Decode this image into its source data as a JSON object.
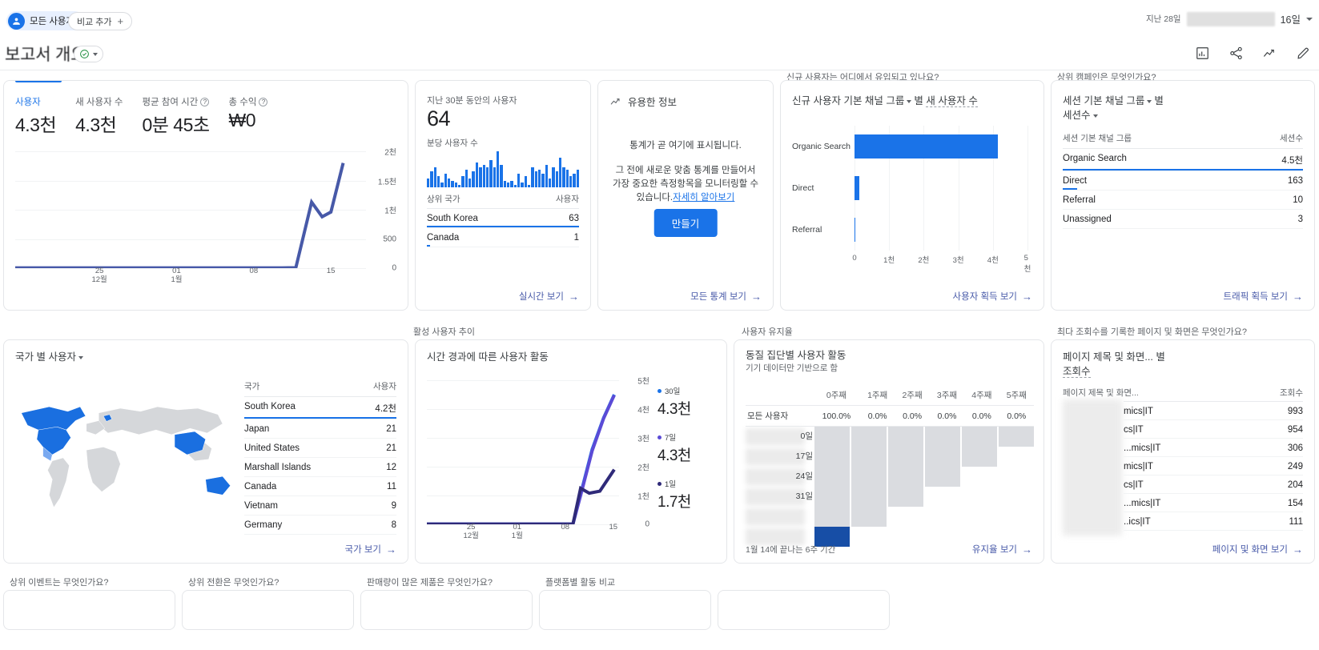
{
  "topbar": {
    "audience_label": "모든 사용자",
    "compare_label": "비교 추가",
    "compare_plus": "+",
    "date_prefix": "지난 28일",
    "date_days": "16일"
  },
  "title": {
    "page_title": "보고서 개요"
  },
  "overview": {
    "metrics": [
      {
        "label": "사용자",
        "value": "4.3천",
        "help": false
      },
      {
        "label": "새 사용자 수",
        "value": "4.3천",
        "help": false
      },
      {
        "label": "평균 참여 시간",
        "value": "0분 45초",
        "help": true
      },
      {
        "label": "총 수익",
        "value": "₩0",
        "help": true
      }
    ]
  },
  "realtime": {
    "sub": "지난 30분 동안의 사용자",
    "value": "64",
    "sub2": "분당 사용자 수",
    "col_country": "상위 국가",
    "col_users": "사용자",
    "rows": [
      {
        "name": "South Korea",
        "value": "63",
        "pct": 100
      },
      {
        "name": "Canada",
        "value": "1",
        "pct": 2
      }
    ],
    "footer": "실시간 보기"
  },
  "insights": {
    "head": "유용한 정보",
    "text1": "통계가 곧 여기에 표시됩니다.",
    "text2": "그 전에 새로운 맞춤 통계를 만들어서 가장 중요한 측정항목을 모니터링할 수 있습니다.",
    "link": "자세히 알아보기",
    "button": "만들기",
    "footer": "모든 통계 보기"
  },
  "acquisition": {
    "section_title": "신규 사용자는 어디에서 유입되고 있나요?",
    "dimension": "신규 사용자 기본 채널 그룹",
    "by": "별",
    "metric": "새 사용자 수",
    "footer": "사용자 획득 보기"
  },
  "campaigns": {
    "section_title": "상위 캠페인은 무엇인가요?",
    "dimension": "세션 기본 채널 그룹",
    "by": "별",
    "metric": "세션수",
    "col_dim": "세션 기본 채널 그룹",
    "col_metric": "세션수",
    "rows": [
      {
        "name": "Organic Search",
        "value": "4.5천",
        "pct": 100
      },
      {
        "name": "Direct",
        "value": "163",
        "pct": 4
      },
      {
        "name": "Referral",
        "value": "10",
        "pct": 0.5
      },
      {
        "name": "Unassigned",
        "value": "3",
        "pct": 0.2
      }
    ],
    "footer": "트래픽 획득 보기"
  },
  "map": {
    "dimension": "국가 별 사용자",
    "col_country": "국가",
    "col_users": "사용자",
    "rows": [
      {
        "name": "South Korea",
        "value": "4.2천",
        "pct": 100
      },
      {
        "name": "Japan",
        "value": "21",
        "pct": 0.5
      },
      {
        "name": "United States",
        "value": "21",
        "pct": 0.5
      },
      {
        "name": "Marshall Islands",
        "value": "12",
        "pct": 0.3
      },
      {
        "name": "Canada",
        "value": "11",
        "pct": 0.3
      },
      {
        "name": "Vietnam",
        "value": "9",
        "pct": 0.2
      },
      {
        "name": "Germany",
        "value": "8",
        "pct": 0.2
      }
    ],
    "footer": "국가 보기"
  },
  "active_users": {
    "section_title": "활성 사용자 추이",
    "card_title": "시간 경과에 따른 사용자 활동",
    "legend": [
      {
        "key": "30일",
        "value": "4.3천",
        "color": "#1a73e8"
      },
      {
        "key": "7일",
        "value": "4.3천",
        "color": "#5b4bd6"
      },
      {
        "key": "1일",
        "value": "1.7천",
        "color": "#2f2a79"
      }
    ]
  },
  "retention": {
    "section_title": "사용자 유지율",
    "card_title": "동질 집단별 사용자 활동",
    "card_sub": "기기 데이터만 기반으로 함",
    "columns": [
      "",
      "0주째",
      "1주째",
      "2주째",
      "3주째",
      "4주째",
      "5주째"
    ],
    "all_users_row": {
      "name": "모든 사용자",
      "values": [
        "100.0%",
        "0.0%",
        "0.0%",
        "0.0%",
        "0.0%",
        "0.0%"
      ]
    },
    "cohort_rows": [
      {
        "label": "0일",
        "cells": [
          "f",
          "f",
          "f",
          "f",
          "f",
          "f"
        ]
      },
      {
        "label": "17일",
        "cells": [
          "f",
          "f",
          "f",
          "f",
          "f",
          "e"
        ]
      },
      {
        "label": "24일",
        "cells": [
          "f",
          "f",
          "f",
          "f",
          "e",
          "e"
        ]
      },
      {
        "label": "31일",
        "cells": [
          "f",
          "f",
          "f",
          "e",
          "e",
          "e"
        ]
      },
      {
        "label": "",
        "cells": [
          "f",
          "f",
          "e",
          "e",
          "e",
          "e"
        ]
      },
      {
        "label": "",
        "cells": [
          "b",
          "e",
          "e",
          "e",
          "e",
          "e"
        ]
      }
    ],
    "note": "1월 14에 끝나는 6주 기간",
    "footer": "유지율 보기"
  },
  "pages": {
    "section_title": "최다 조회수를 기록한 페이지 및 화면은 무엇인가요?",
    "dimension": "페이지 제목 및 화면...",
    "by": "별",
    "metric": "조회수",
    "col_dim": "페이지 제목 및 화면...",
    "col_metric": "조회수",
    "rows": [
      {
        "name": "mics|IT",
        "value": "993"
      },
      {
        "name": "cs|IT",
        "value": "954"
      },
      {
        "name": "...mics|IT",
        "value": "306"
      },
      {
        "name": "mics|IT",
        "value": "249"
      },
      {
        "name": "cs|IT",
        "value": "204"
      },
      {
        "name": "...mics|IT",
        "value": "154"
      },
      {
        "name": "..ics|IT",
        "value": "111"
      }
    ],
    "footer": "페이지 및 화면 보기"
  },
  "bottom_sections": [
    {
      "title": "상위 이벤트는 무엇인가요?"
    },
    {
      "title": "상위 전환은 무엇인가요?"
    },
    {
      "title": "판매량이 많은 제품은 무엇인가요?"
    },
    {
      "title": "플랫폼별 활동 비교"
    }
  ],
  "chart_data": [
    {
      "type": "line",
      "id": "overview-users-over-time",
      "title": "사용자",
      "xlabel": "",
      "ylabel": "",
      "ylim": [
        0,
        2000
      ],
      "yticks": [
        "0",
        "500",
        "1천",
        "1.5천",
        "2천"
      ],
      "xticks": [
        {
          "label": "25",
          "sub": "12월",
          "pos": 0.24
        },
        {
          "label": "01",
          "sub": "1월",
          "pos": 0.46
        },
        {
          "label": "08",
          "sub": "",
          "pos": 0.68
        },
        {
          "label": "15",
          "sub": "",
          "pos": 0.9
        }
      ],
      "series": [
        {
          "name": "사용자",
          "color": "#4759a8",
          "x": [
            0,
            0.1,
            0.24,
            0.35,
            0.46,
            0.57,
            0.68,
            0.76,
            0.8,
            0.845,
            0.875,
            0.9,
            0.935
          ],
          "values": [
            5,
            5,
            5,
            5,
            5,
            5,
            5,
            5,
            8,
            1130,
            880,
            960,
            1800
          ]
        }
      ]
    },
    {
      "type": "bar",
      "id": "realtime-users-per-minute",
      "title": "분당 사용자 수",
      "values": [
        4,
        7,
        9,
        5,
        2,
        6,
        4,
        3,
        2,
        1,
        5,
        8,
        4,
        7,
        11,
        9,
        10,
        9,
        12,
        9,
        16,
        10,
        3,
        2,
        3,
        1,
        6,
        2,
        5,
        1,
        9,
        7,
        8,
        6,
        10,
        4,
        9,
        7,
        13,
        9,
        8,
        5,
        6,
        8
      ],
      "ylim": [
        0,
        16
      ]
    },
    {
      "type": "bar",
      "id": "new-users-by-channel",
      "orientation": "horizontal",
      "title": "신규 사용자 기본 채널 그룹 별 새 사용자 수",
      "categories": [
        "Organic Search",
        "Direct",
        "Referral"
      ],
      "values": [
        4150,
        150,
        8
      ],
      "xlim": [
        0,
        5000
      ],
      "xticks": [
        "0",
        "1천",
        "2천",
        "3천",
        "4천",
        "5천"
      ],
      "color": "#1a73e8"
    },
    {
      "type": "line",
      "id": "active-users-over-time",
      "title": "시간 경과에 따른 사용자 활동",
      "ylim": [
        0,
        5000
      ],
      "yticks": [
        "0",
        "1천",
        "2천",
        "3천",
        "4천",
        "5천"
      ],
      "xticks": [
        {
          "label": "25",
          "sub": "12월",
          "pos": 0.23
        },
        {
          "label": "01",
          "sub": "1월",
          "pos": 0.47
        },
        {
          "label": "08",
          "sub": "",
          "pos": 0.72
        },
        {
          "label": "15",
          "sub": "",
          "pos": 0.97
        }
      ],
      "series": [
        {
          "name": "30일",
          "color": "#1a73e8",
          "x": [
            0,
            0.2,
            0.4,
            0.6,
            0.76,
            0.8,
            0.86,
            0.92,
            0.975
          ],
          "values": [
            10,
            10,
            10,
            10,
            10,
            1050,
            2600,
            3700,
            4500
          ]
        },
        {
          "name": "7일",
          "color": "#5b4bd6",
          "x": [
            0,
            0.2,
            0.4,
            0.6,
            0.76,
            0.8,
            0.86,
            0.92,
            0.975
          ],
          "values": [
            8,
            8,
            8,
            8,
            8,
            1000,
            2550,
            3680,
            4480
          ]
        },
        {
          "name": "1일",
          "color": "#2f2a79",
          "x": [
            0,
            0.2,
            0.4,
            0.6,
            0.76,
            0.8,
            0.845,
            0.9,
            0.975
          ],
          "values": [
            6,
            6,
            6,
            6,
            6,
            1250,
            1080,
            1150,
            1900
          ]
        }
      ]
    },
    {
      "type": "table",
      "id": "retention-cohort",
      "title": "동질 집단별 사용자 활동",
      "columns": [
        "0주째",
        "1주째",
        "2주째",
        "3주째",
        "4주째",
        "5주째"
      ],
      "rows": [
        {
          "name": "모든 사용자",
          "values": [
            "100.0%",
            "0.0%",
            "0.0%",
            "0.0%",
            "0.0%",
            "0.0%"
          ]
        }
      ]
    }
  ]
}
